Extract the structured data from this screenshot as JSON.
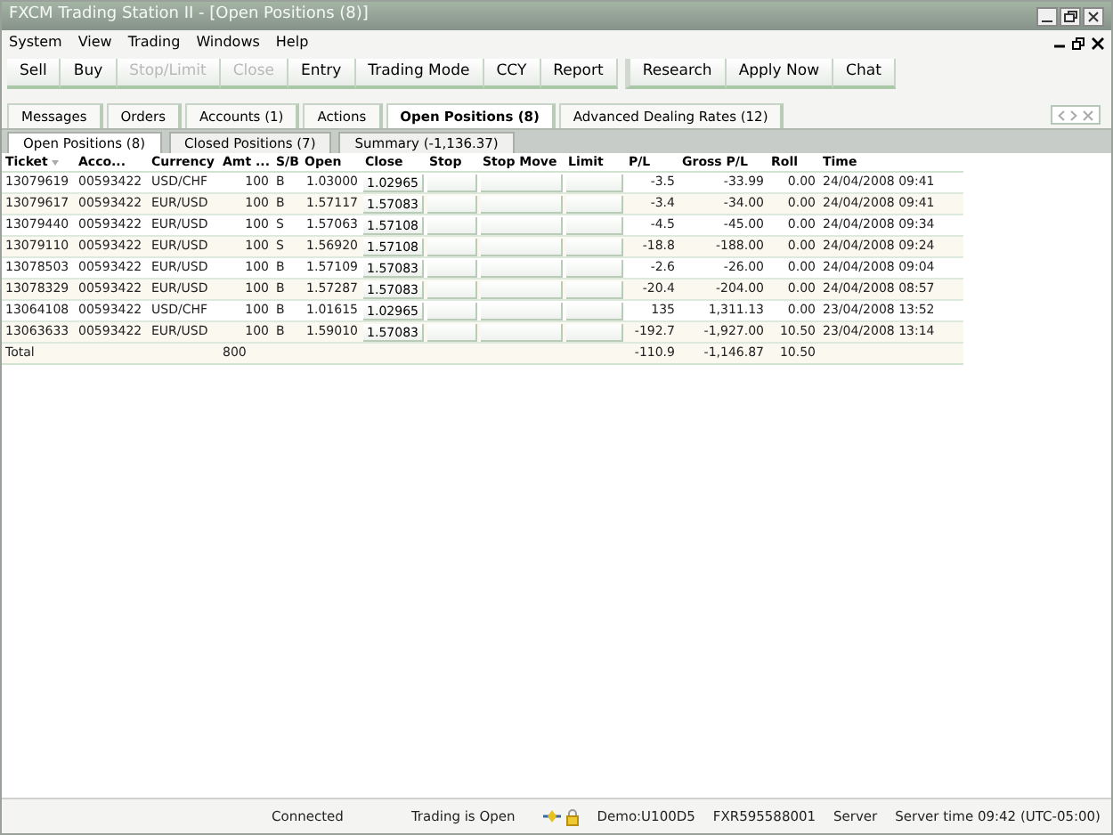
{
  "window": {
    "title": "FXCM Trading Station II - [Open Positions (8)]"
  },
  "menu": [
    "System",
    "View",
    "Trading",
    "Windows",
    "Help"
  ],
  "toolbar": [
    {
      "label": "Sell",
      "disabled": false,
      "group_start": false
    },
    {
      "label": "Buy",
      "disabled": false,
      "group_start": false
    },
    {
      "label": "Stop/Limit",
      "disabled": true,
      "group_start": false
    },
    {
      "label": "Close",
      "disabled": true,
      "group_start": false
    },
    {
      "label": "Entry",
      "disabled": false,
      "group_start": false
    },
    {
      "label": "Trading Mode",
      "disabled": false,
      "group_start": false
    },
    {
      "label": "CCY",
      "disabled": false,
      "group_start": false
    },
    {
      "label": "Report",
      "disabled": false,
      "group_start": false
    },
    {
      "label": "Research",
      "disabled": false,
      "group_start": true
    },
    {
      "label": "Apply Now",
      "disabled": false,
      "group_start": false
    },
    {
      "label": "Chat",
      "disabled": false,
      "group_start": false
    }
  ],
  "tabs": [
    {
      "label": "Messages",
      "selected": false
    },
    {
      "label": "Orders",
      "selected": false
    },
    {
      "label": "Accounts (1)",
      "selected": false
    },
    {
      "label": "Actions",
      "selected": false
    },
    {
      "label": "Open Positions (8)",
      "selected": true
    },
    {
      "label": "Advanced Dealing Rates (12)",
      "selected": false
    }
  ],
  "subtabs": [
    {
      "label": "Open Positions (8)",
      "selected": true
    },
    {
      "label": "Closed Positions (7)",
      "selected": false
    },
    {
      "label": "Summary (-1,136.37)",
      "selected": false
    }
  ],
  "table": {
    "columns": [
      "Ticket",
      "Acco...",
      "Currency",
      "Amt ...",
      "S/B",
      "Open",
      "Close",
      "Stop",
      "Stop Move",
      "Limit",
      "P/L",
      "Gross P/L",
      "Roll",
      "Time"
    ],
    "rows": [
      [
        "13079619",
        "00593422",
        "USD/CHF",
        "100",
        "B",
        "1.03000",
        "1.02965",
        "",
        "",
        "",
        "-3.5",
        "-33.99",
        "0.00",
        "24/04/2008 09:41"
      ],
      [
        "13079617",
        "00593422",
        "EUR/USD",
        "100",
        "B",
        "1.57117",
        "1.57083",
        "",
        "",
        "",
        "-3.4",
        "-34.00",
        "0.00",
        "24/04/2008 09:41"
      ],
      [
        "13079440",
        "00593422",
        "EUR/USD",
        "100",
        "S",
        "1.57063",
        "1.57108",
        "",
        "",
        "",
        "-4.5",
        "-45.00",
        "0.00",
        "24/04/2008 09:34"
      ],
      [
        "13079110",
        "00593422",
        "EUR/USD",
        "100",
        "S",
        "1.56920",
        "1.57108",
        "",
        "",
        "",
        "-18.8",
        "-188.00",
        "0.00",
        "24/04/2008 09:24"
      ],
      [
        "13078503",
        "00593422",
        "EUR/USD",
        "100",
        "B",
        "1.57109",
        "1.57083",
        "",
        "",
        "",
        "-2.6",
        "-26.00",
        "0.00",
        "24/04/2008 09:04"
      ],
      [
        "13078329",
        "00593422",
        "EUR/USD",
        "100",
        "B",
        "1.57287",
        "1.57083",
        "",
        "",
        "",
        "-20.4",
        "-204.00",
        "0.00",
        "24/04/2008 08:57"
      ],
      [
        "13064108",
        "00593422",
        "USD/CHF",
        "100",
        "B",
        "1.01615",
        "1.02965",
        "",
        "",
        "",
        "135",
        "1,311.13",
        "0.00",
        "23/04/2008 13:52"
      ],
      [
        "13063633",
        "00593422",
        "EUR/USD",
        "100",
        "B",
        "1.59010",
        "1.57083",
        "",
        "",
        "",
        "-192.7",
        "-1,927.00",
        "10.50",
        "23/04/2008 13:14"
      ]
    ],
    "total": {
      "label": "Total",
      "amount": "800",
      "pl": "-110.9",
      "gross_pl": "-1,146.87",
      "roll": "10.50"
    }
  },
  "status_bar": {
    "connection": "Connected",
    "market": "Trading is Open",
    "account": "Demo:U100D5",
    "id": "FXR595588001",
    "server": "Server",
    "server_time": "Server time 09:42 (UTC-05:00)"
  }
}
